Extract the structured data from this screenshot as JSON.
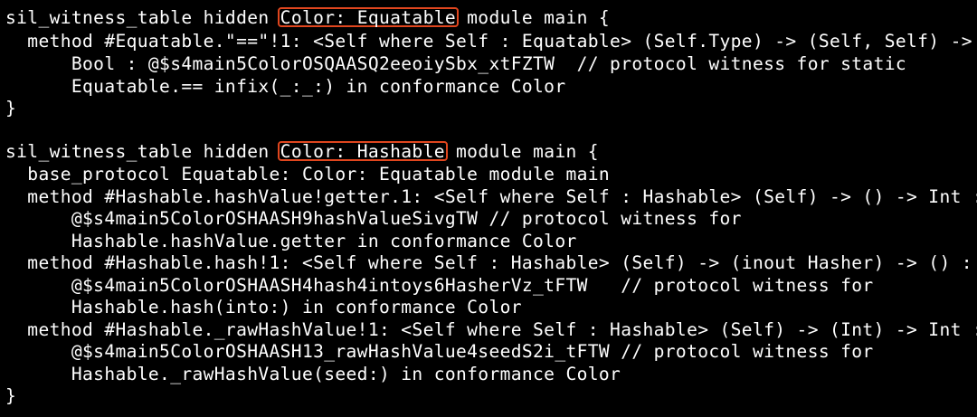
{
  "block1": {
    "l1_pre": "sil_witness_table hidden ",
    "l1_hl": "Color: Equatable",
    "l1_post": " module main {",
    "l2": "  method #Equatable.\"==\"!1: <Self where Self : Equatable> (Self.Type) -> (Self, Self) ->",
    "l3": "      Bool : @$s4main5ColorOSQAASQ2eeoiySbx_xtFZTW  // protocol witness for static",
    "l4": "      Equatable.== infix(_:_:) in conformance Color",
    "l5": "}"
  },
  "block2": {
    "l1_pre": "sil_witness_table hidden ",
    "l1_hl": "Color: Hashable",
    "l1_post": " module main {",
    "l2": "  base_protocol Equatable: Color: Equatable module main",
    "l3": "  method #Hashable.hashValue!getter.1: <Self where Self : Hashable> (Self) -> () -> Int :",
    "l4": "      @$s4main5ColorOSHAASH9hashValueSivgTW // protocol witness for",
    "l5": "      Hashable.hashValue.getter in conformance Color",
    "l6": "  method #Hashable.hash!1: <Self where Self : Hashable> (Self) -> (inout Hasher) -> () :",
    "l7": "      @$s4main5ColorOSHAASH4hash4intoys6HasherVz_tFTW   // protocol witness for",
    "l8": "      Hashable.hash(into:) in conformance Color",
    "l9": "  method #Hashable._rawHashValue!1: <Self where Self : Hashable> (Self) -> (Int) -> Int :",
    "l10": "      @$s4main5ColorOSHAASH13_rawHashValue4seedS2i_tFTW // protocol witness for",
    "l11": "      Hashable._rawHashValue(seed:) in conformance Color",
    "l12": "}"
  },
  "colors": {
    "background": "#000000",
    "text": "#ffffff",
    "highlight_border": "#e0461e"
  }
}
